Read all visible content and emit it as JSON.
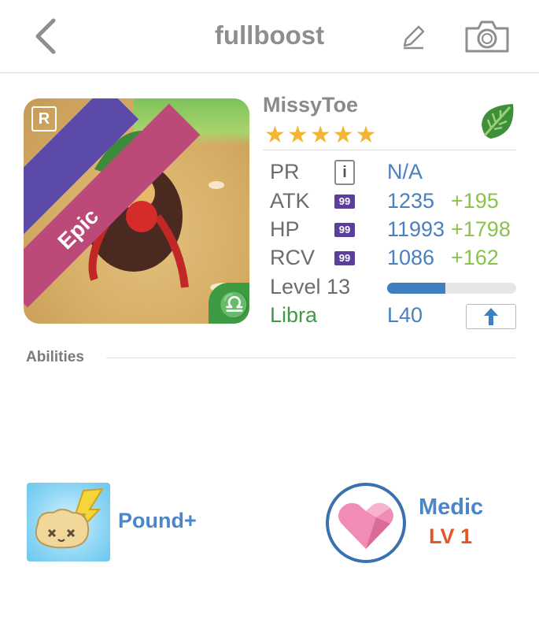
{
  "header": {
    "title": "fullboost",
    "back": "chevron-left",
    "edit": "pencil",
    "camera": "camera"
  },
  "monster": {
    "name": "MissyToe",
    "stars": "★★★★★",
    "rarity": "Epic",
    "rank_letter": "R",
    "zodiac_symbol": "♎",
    "element": "leaf"
  },
  "stats": {
    "pr": {
      "label": "PR",
      "value": "N/A"
    },
    "atk": {
      "label": "ATK",
      "badge": "99",
      "value": "1235",
      "bonus": "+195"
    },
    "hp": {
      "label": "HP",
      "badge": "99",
      "value": "11993",
      "bonus": "+1798"
    },
    "rcv": {
      "label": "RCV",
      "badge": "99",
      "value": "1086",
      "bonus": "+162"
    },
    "level": {
      "label": "Level 13",
      "progress": 0.45
    },
    "sign": {
      "label": "Libra",
      "max_level": "L40"
    }
  },
  "abilities": {
    "title": "Abilities",
    "ability1": {
      "name": "Pound+"
    },
    "ability2": {
      "name": "Medic",
      "level": "LV 1"
    }
  },
  "colors": {
    "accent_blue": "#4a7fc0",
    "bonus_green": "#8bc34a",
    "medic_orange": "#e2572a",
    "libra_green": "#3f9a44"
  }
}
